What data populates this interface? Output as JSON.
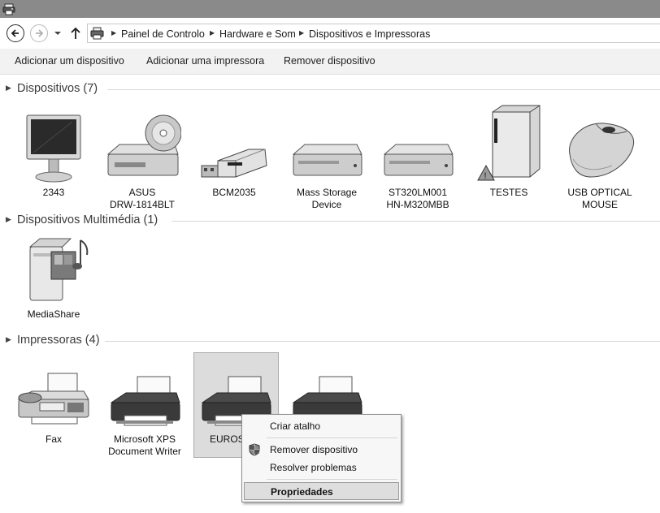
{
  "window": {
    "icon": "printer-control-panel-icon"
  },
  "nav": {
    "back_icon": "back-arrow-icon",
    "forward_icon": "forward-arrow-icon",
    "recent_icon": "chevron-down-icon",
    "up_icon": "up-arrow-icon"
  },
  "address": {
    "icon": "devices-printers-icon",
    "breadcrumbs": [
      "Painel de Controlo",
      "Hardware e Som",
      "Dispositivos e Impressoras"
    ]
  },
  "toolbar": {
    "add_device": "Adicionar um dispositivo",
    "add_printer": "Adicionar uma impressora",
    "remove_device": "Remover dispositivo"
  },
  "groups": {
    "devices": {
      "title": "Dispositivos (7)",
      "items": [
        {
          "label": "2343",
          "icon": "monitor-icon"
        },
        {
          "label": "ASUS\nDRW-1814BLT",
          "icon": "optical-drive-icon"
        },
        {
          "label": "BCM2035",
          "icon": "usb-dongle-icon"
        },
        {
          "label": "Mass Storage\nDevice",
          "icon": "hard-drive-icon"
        },
        {
          "label": "ST320LM001\nHN-M320MBB",
          "icon": "hard-drive-icon"
        },
        {
          "label": "TESTES",
          "icon": "computer-tower-warning-icon"
        },
        {
          "label": "USB OPTICAL\nMOUSE",
          "icon": "mouse-icon"
        }
      ]
    },
    "multimedia": {
      "title": "Dispositivos Multimédia (1)",
      "items": [
        {
          "label": "MediaShare",
          "icon": "media-server-icon"
        }
      ]
    },
    "printers": {
      "title": "Impressoras (4)",
      "items": [
        {
          "label": "Fax",
          "icon": "fax-icon"
        },
        {
          "label": "Microsoft XPS\nDocument Writer",
          "icon": "printer-icon"
        },
        {
          "label": "EUROSY",
          "icon": "printer-icon"
        },
        {
          "label": "",
          "icon": "printer-icon"
        }
      ]
    }
  },
  "context_menu": {
    "items": [
      {
        "label": "Criar atalho"
      },
      {
        "label": "Remover dispositivo",
        "icon": "uac-shield-icon"
      },
      {
        "label": "Resolver problemas"
      },
      {
        "label": "Propriedades",
        "highlighted": true
      }
    ]
  }
}
